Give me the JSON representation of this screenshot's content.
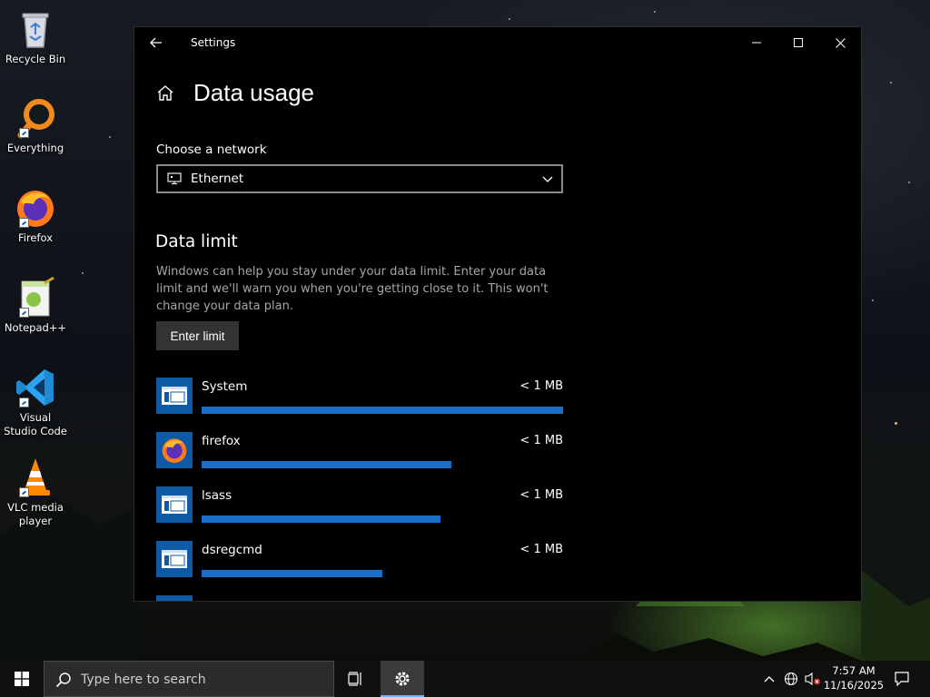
{
  "desktop": {
    "icons": [
      {
        "label": "Recycle Bin",
        "icon": "recycle-bin-icon"
      },
      {
        "label": "Everything",
        "icon": "everything-icon"
      },
      {
        "label": "Firefox",
        "icon": "firefox-icon"
      },
      {
        "label": "Notepad++",
        "icon": "notepad-plus-plus-icon"
      },
      {
        "label": "Visual Studio Code",
        "icon": "vscode-icon"
      },
      {
        "label": "VLC media player",
        "icon": "vlc-icon"
      }
    ]
  },
  "window": {
    "title": "Settings",
    "page_title": "Data usage",
    "network_label": "Choose a network",
    "network_value": "Ethernet",
    "section_title": "Data limit",
    "description": "Windows can help you stay under your data limit. Enter your data limit and we'll warn you when you're getting close to it. This won't change your data plan.",
    "enter_limit_label": "Enter limit",
    "apps": [
      {
        "name": "System",
        "usage": "< 1 MB",
        "fraction": 1.0,
        "icon": "system-app-icon"
      },
      {
        "name": "firefox",
        "usage": "< 1 MB",
        "fraction": 0.69,
        "icon": "firefox-icon"
      },
      {
        "name": "lsass",
        "usage": "< 1 MB",
        "fraction": 0.66,
        "icon": "system-app-icon"
      },
      {
        "name": "dsregcmd",
        "usage": "< 1 MB",
        "fraction": 0.5,
        "icon": "system-app-icon"
      }
    ]
  },
  "taskbar": {
    "search_placeholder": "Type here to search",
    "time": "7:57 AM",
    "date": "11/16/2025"
  },
  "colors": {
    "accent": "#1c6fc9",
    "window_bg": "#000000",
    "app_icon_bg": "#0f5aa6",
    "taskbar_bg": "#101010"
  }
}
